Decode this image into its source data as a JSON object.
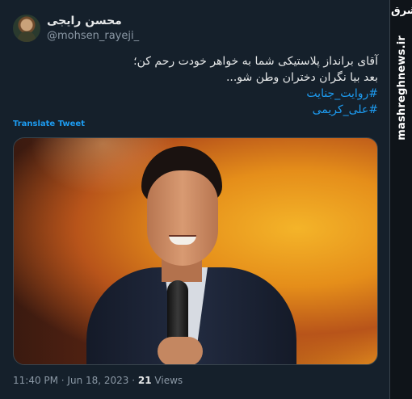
{
  "tweet": {
    "display_name": "محسن رایجی",
    "handle": "@mohsen_rayeji_",
    "text_lines": [
      "آقای برانداز پلاستیکی شما به خواهر خودت رحم کن؛",
      "بعد بیا نگران دختران وطن شو..."
    ],
    "hashtags": [
      "#روایت_جنایت",
      "#علی_کریمی"
    ],
    "translate_label": "Translate Tweet",
    "timestamp": "11:40 PM · Jun 18, 2023",
    "separator": " · ",
    "views_count": "21",
    "views_label": " Views"
  },
  "watermark": {
    "logo_text": "مشرق",
    "site": "mashreghnews.ir"
  }
}
